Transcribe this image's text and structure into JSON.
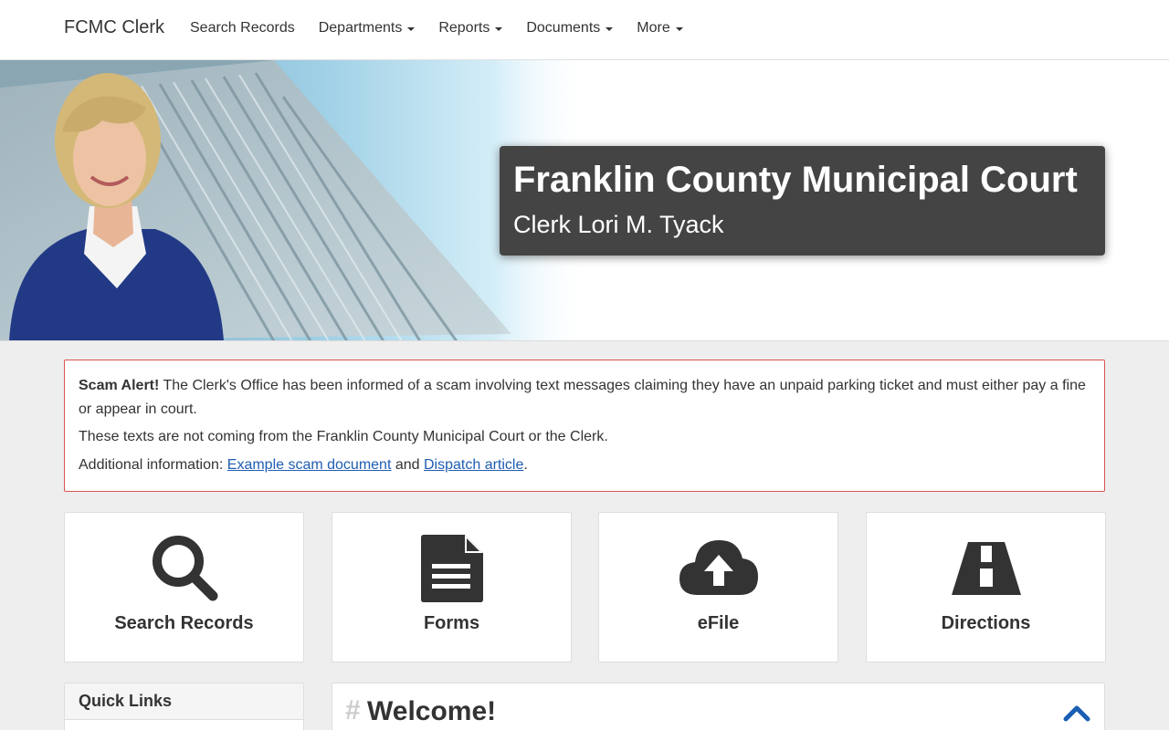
{
  "navbar": {
    "brand": "FCMC Clerk",
    "items": [
      {
        "label": "Search Records",
        "dropdown": false
      },
      {
        "label": "Departments",
        "dropdown": true
      },
      {
        "label": "Reports",
        "dropdown": true
      },
      {
        "label": "Documents",
        "dropdown": true
      },
      {
        "label": "More",
        "dropdown": true
      }
    ]
  },
  "hero": {
    "title": "Franklin County Municipal Court",
    "subtitle": "Clerk Lori M. Tyack"
  },
  "alert": {
    "lead": "Scam Alert!",
    "text1": " The Clerk's Office has been informed of a scam involving text messages claiming they have an unpaid parking ticket and must either pay a fine or appear in court.",
    "text2": "These texts are not coming from the Franklin County Municipal Court or the Clerk.",
    "text3_prefix": "Additional information: ",
    "link1": "Example scam document",
    "text3_mid": " and ",
    "link2": "Dispatch article",
    "text3_suffix": "."
  },
  "tiles": [
    {
      "label": "Search Records",
      "icon": "search-icon"
    },
    {
      "label": "Forms",
      "icon": "document-icon"
    },
    {
      "label": "eFile",
      "icon": "cloud-upload-icon"
    },
    {
      "label": "Directions",
      "icon": "road-icon"
    }
  ],
  "quick_links": {
    "title": "Quick Links"
  },
  "welcome": {
    "hash": "#",
    "title": "Welcome!"
  },
  "colors": {
    "accent_link": "#1f5db3",
    "alert_border": "#d9534f",
    "title_box": "#444444",
    "chevron": "#1a5fb4"
  }
}
